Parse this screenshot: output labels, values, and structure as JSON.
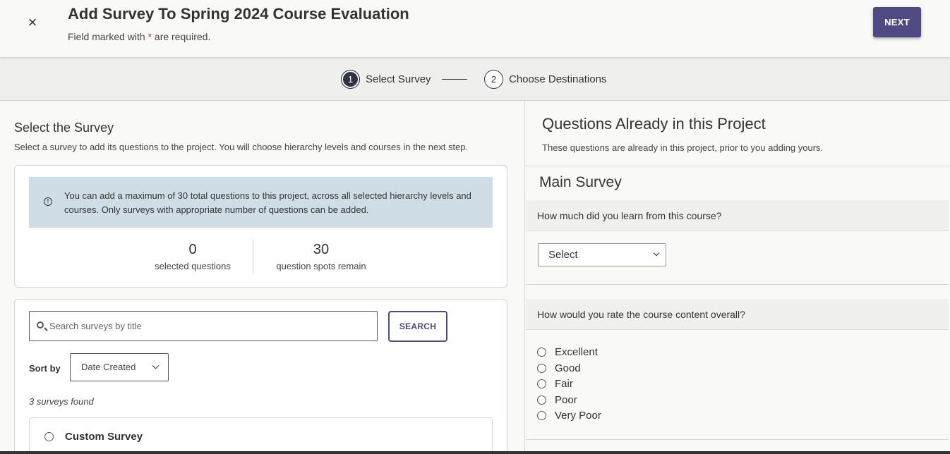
{
  "header": {
    "close_symbol": "×",
    "title": "Add Survey To Spring 2024 Course Evaluation",
    "subtitle_prefix": "Field marked with ",
    "required_mark": "*",
    "subtitle_suffix": " are required.",
    "next_label": "NEXT"
  },
  "stepper": {
    "steps": [
      {
        "number": "1",
        "label": "Select Survey",
        "active": true
      },
      {
        "number": "2",
        "label": "Choose Destinations",
        "active": false
      }
    ]
  },
  "left": {
    "title": "Select the Survey",
    "description": "Select a survey to add its questions to the project. You will choose hierarchy levels and courses in the next step.",
    "info_icon": "!",
    "info_text": "You can add a maximum of 30 total questions to this project, across all selected hierarchy levels and courses. Only surveys with appropriate number of questions can be added.",
    "stats": [
      {
        "value": "0",
        "label": "selected questions"
      },
      {
        "value": "30",
        "label": "question spots remain"
      }
    ],
    "search": {
      "placeholder": "Search surveys by title",
      "value": "",
      "button_label": "SEARCH"
    },
    "sort": {
      "label": "Sort by",
      "selected": "Date Created"
    },
    "found_text": "3 surveys found",
    "surveys": [
      {
        "name": "Custom Survey"
      }
    ]
  },
  "right": {
    "title": "Questions Already in this Project",
    "description": "These questions are already in this project, prior to you adding yours.",
    "section_title": "Main Survey",
    "questions": [
      {
        "text": "How much did you learn from this course?",
        "type": "select",
        "selected": "Select"
      },
      {
        "text": "How would you rate the course content overall?",
        "type": "radio",
        "options": [
          "Excellent",
          "Good",
          "Fair",
          "Poor",
          "Very Poor"
        ]
      }
    ]
  },
  "icons": {
    "close": "close-icon",
    "info": "info-icon",
    "search": "search-icon",
    "chevron": "chevron-down-icon"
  },
  "colors": {
    "primary": "#4f4a82",
    "info_bg": "#cfdde7",
    "required": "#c0392b"
  }
}
